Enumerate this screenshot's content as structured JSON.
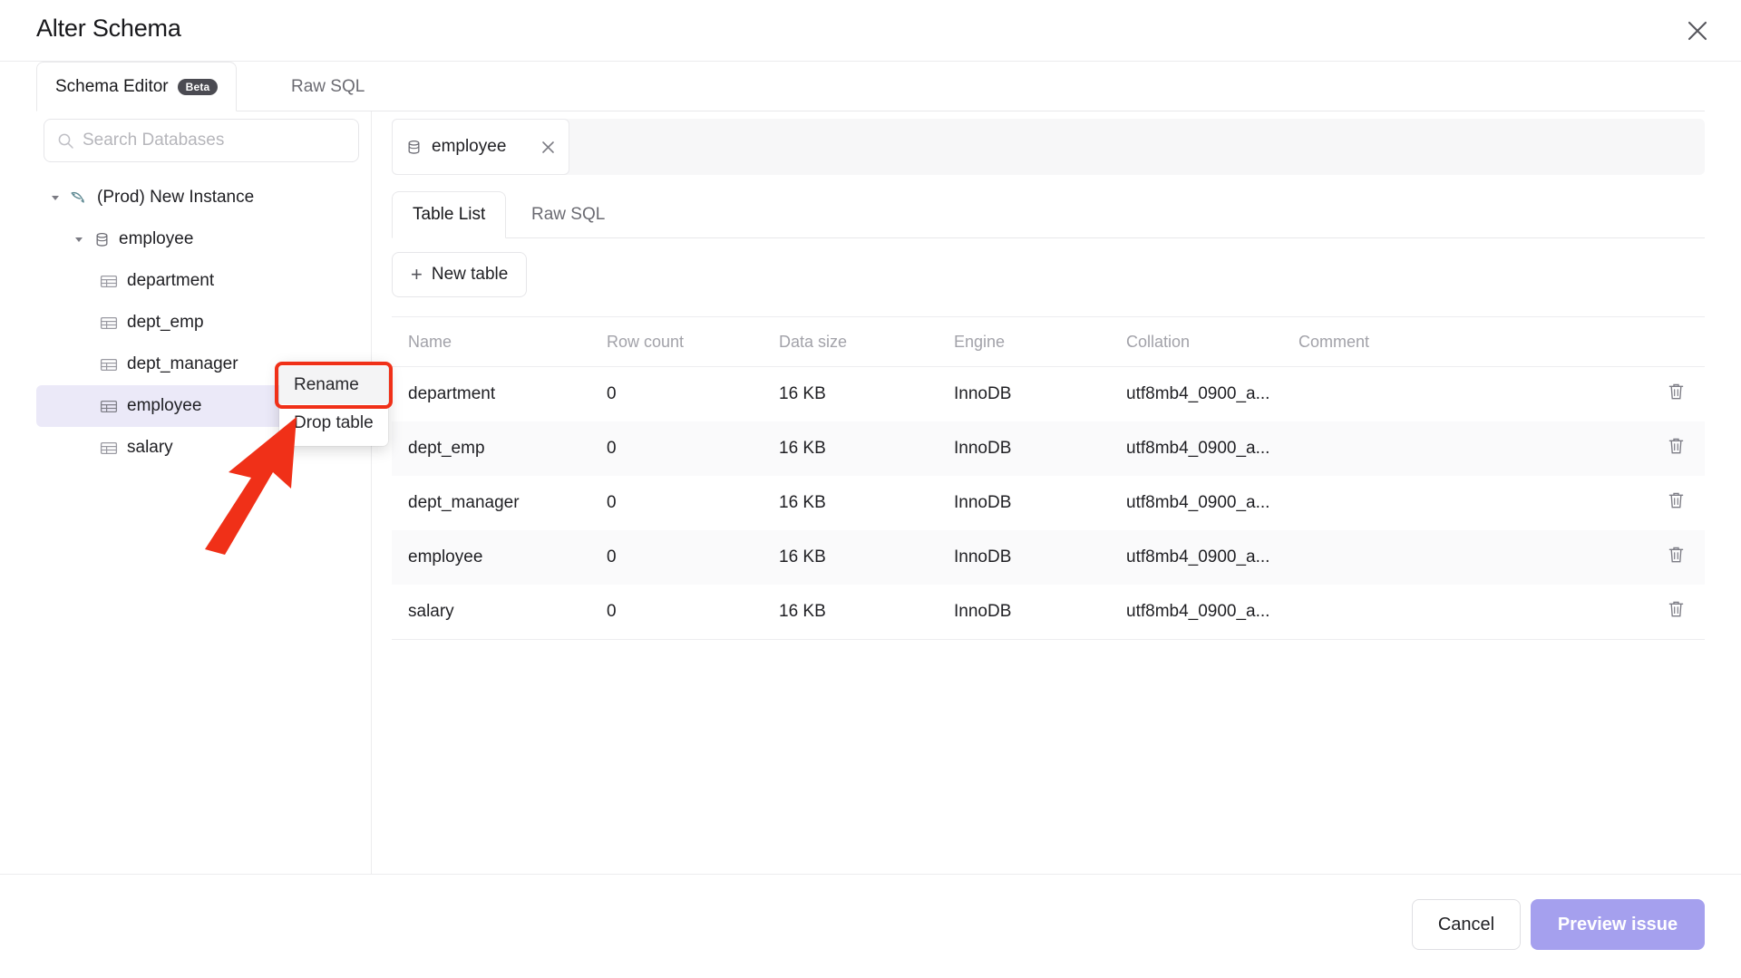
{
  "dialog": {
    "title": "Alter Schema",
    "close_icon": "close-icon"
  },
  "top_tabs": [
    {
      "label": "Schema Editor",
      "badge": "Beta",
      "active": true
    },
    {
      "label": "Raw SQL",
      "badge": "",
      "active": false
    }
  ],
  "sidebar": {
    "search": {
      "placeholder": "Search Databases",
      "value": "",
      "icon": "search-icon"
    },
    "tree": [
      {
        "label": "(Prod) New Instance",
        "icon": "mysql-dolphin-icon",
        "depth": 0,
        "expanded": true,
        "selected": false
      },
      {
        "label": "employee",
        "icon": "database-icon",
        "depth": 1,
        "expanded": true,
        "selected": false
      },
      {
        "label": "department",
        "icon": "table-icon",
        "depth": 2,
        "expanded": null,
        "selected": false
      },
      {
        "label": "dept_emp",
        "icon": "table-icon",
        "depth": 2,
        "expanded": null,
        "selected": false
      },
      {
        "label": "dept_manager",
        "icon": "table-icon",
        "depth": 2,
        "expanded": null,
        "selected": false
      },
      {
        "label": "employee",
        "icon": "table-icon",
        "depth": 2,
        "expanded": null,
        "selected": true,
        "more": "..."
      },
      {
        "label": "salary",
        "icon": "table-icon",
        "depth": 2,
        "expanded": null,
        "selected": false
      }
    ]
  },
  "context_menu": {
    "items": [
      {
        "label": "Rename",
        "highlighted": true
      },
      {
        "label": "Drop table",
        "highlighted": false
      }
    ],
    "highlight_color": "#f03018",
    "arrow_color": "#f03018"
  },
  "main": {
    "db_tab": {
      "label": "employee",
      "icon": "database-icon",
      "close_icon": "close-icon"
    },
    "inner_tabs": [
      {
        "label": "Table List",
        "active": true
      },
      {
        "label": "Raw SQL",
        "active": false
      }
    ],
    "new_table_button": {
      "label": "New table",
      "icon": "plus-icon"
    },
    "table": {
      "columns": [
        "Name",
        "Row count",
        "Data size",
        "Engine",
        "Collation",
        "Comment"
      ],
      "rows": [
        {
          "name": "department",
          "row_count": "0",
          "data_size": "16 KB",
          "engine": "InnoDB",
          "collation": "utf8mb4_0900_a...",
          "comment": ""
        },
        {
          "name": "dept_emp",
          "row_count": "0",
          "data_size": "16 KB",
          "engine": "InnoDB",
          "collation": "utf8mb4_0900_a...",
          "comment": ""
        },
        {
          "name": "dept_manager",
          "row_count": "0",
          "data_size": "16 KB",
          "engine": "InnoDB",
          "collation": "utf8mb4_0900_a...",
          "comment": ""
        },
        {
          "name": "employee",
          "row_count": "0",
          "data_size": "16 KB",
          "engine": "InnoDB",
          "collation": "utf8mb4_0900_a...",
          "comment": ""
        },
        {
          "name": "salary",
          "row_count": "0",
          "data_size": "16 KB",
          "engine": "InnoDB",
          "collation": "utf8mb4_0900_a...",
          "comment": ""
        }
      ],
      "row_delete_icon": "trash-icon"
    }
  },
  "footer": {
    "cancel_label": "Cancel",
    "preview_label": "Preview issue",
    "preview_color": "#a5a0ee"
  }
}
